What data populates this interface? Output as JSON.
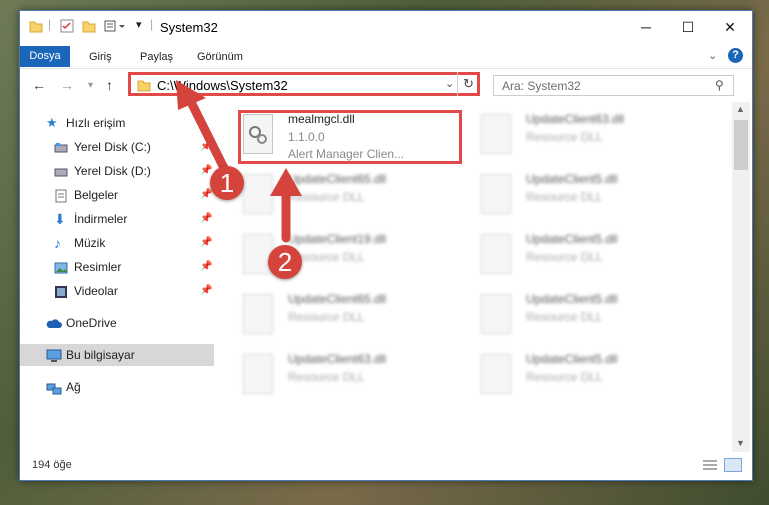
{
  "window": {
    "title": "System32",
    "min": "─",
    "max": "☐",
    "close": "✕"
  },
  "ribbon": {
    "tabs": [
      "Dosya",
      "Giriş",
      "Paylaş",
      "Görünüm"
    ],
    "help": "?"
  },
  "address": {
    "path": "C:\\Windows\\System32",
    "search_placeholder": "Ara: System32"
  },
  "sidebar": {
    "items": [
      {
        "label": "Hızlı erişim"
      },
      {
        "label": "Yerel Disk (C:)"
      },
      {
        "label": "Yerel Disk (D:)"
      },
      {
        "label": "Belgeler"
      },
      {
        "label": "İndirmeler"
      },
      {
        "label": "Müzik"
      },
      {
        "label": "Resimler"
      },
      {
        "label": "Videolar"
      },
      {
        "label": "OneDrive"
      },
      {
        "label": "Bu bilgisayar"
      },
      {
        "label": "Ağ"
      }
    ]
  },
  "files": [
    {
      "name": "mealmgcl.dll",
      "version": "1.1.0.0",
      "desc": "Alert Manager Clien..."
    },
    {
      "name": "UpdateClient63.dll",
      "desc": "Resource DLL"
    },
    {
      "name": "UpdateClient65.dll",
      "desc": "Resource DLL"
    },
    {
      "name": "UpdateClient5.dll",
      "desc": "Resource DLL"
    },
    {
      "name": "UpdateClient19.dll",
      "desc": "Resource DLL"
    },
    {
      "name": "UpdateClient5.dll",
      "desc": "Resource DLL"
    },
    {
      "name": "UpdateClient65.dll",
      "desc": "Resource DLL"
    },
    {
      "name": "UpdateClient5.dll",
      "desc": "Resource DLL"
    },
    {
      "name": "UpdateClient63.dll",
      "desc": "Resource DLL"
    },
    {
      "name": "UpdateClient5.dll",
      "desc": "Resource DLL"
    }
  ],
  "status": {
    "count": "194 öğe"
  },
  "annotations": {
    "step1": "1",
    "step2": "2"
  },
  "colors": {
    "accent": "#1a66b8",
    "highlight": "#e24a4a"
  }
}
